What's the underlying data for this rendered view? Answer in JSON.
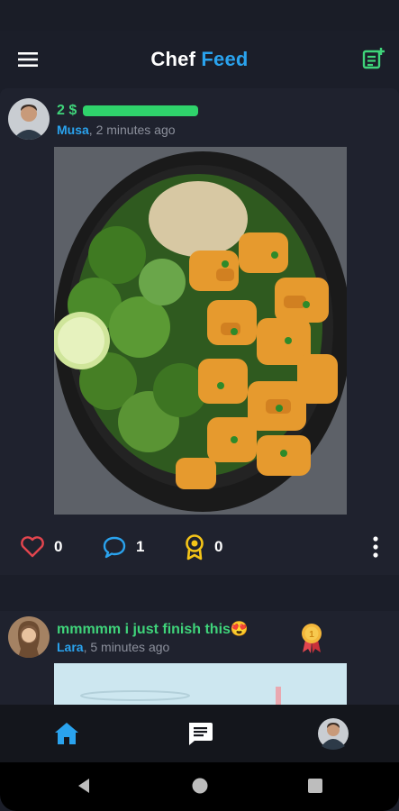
{
  "app": {
    "title_part1": "Chef",
    "title_part2": "Feed",
    "colors": {
      "accent": "#2aa3ee",
      "title_green": "#3fd47a",
      "background": "#1b1e29",
      "like": "#e2454e",
      "medal": "#f5c518"
    }
  },
  "posts": [
    {
      "title": "2 $",
      "author": "Musa",
      "time": ", 2 minutes ago",
      "likes": "0",
      "comments": "1",
      "awards": "0",
      "icons": [
        "heart-icon",
        "comment-icon",
        "award-icon",
        "more-vert-icon"
      ]
    },
    {
      "title": "mmmmm i just finish this😍",
      "author": "Lara",
      "time": ", 5 minutes ago",
      "badge": "medal-icon"
    }
  ],
  "bottom_nav": [
    "home-icon",
    "chat-icon",
    "profile-avatar"
  ],
  "system_nav": [
    "back-icon",
    "home-circle-icon",
    "recents-icon"
  ]
}
